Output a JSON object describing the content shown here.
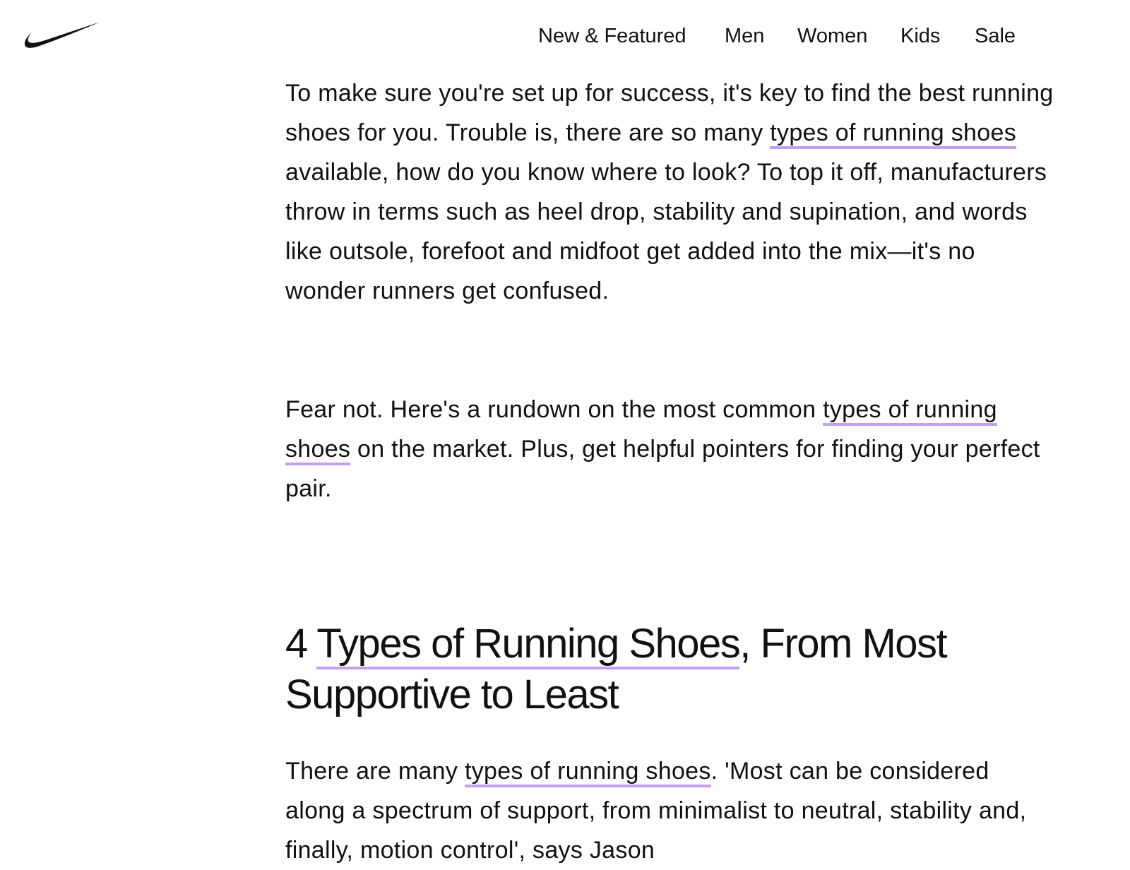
{
  "header": {
    "logo": {
      "icon": "swoosh-icon",
      "color": "#111111"
    },
    "nav": [
      {
        "label": "New & Featured"
      },
      {
        "label": "Men"
      },
      {
        "label": "Women"
      },
      {
        "label": "Kids"
      },
      {
        "label": "Sale"
      }
    ]
  },
  "article": {
    "p1": {
      "before": "To make sure you're set up for success, it's key to find the best running shoes for you. Trouble is, there are so many ",
      "link": "types of running shoes",
      "after": " available, how do you know where to look? To top it off, manufacturers throw in terms such as heel drop, stability and supination, and words like outsole, forefoot and midfoot get added into the mix—it's no wonder runners get confused."
    },
    "p2": {
      "before": "Fear not. Here's a rundown on the most common ",
      "link": "types of running shoes",
      "after": " on the market. Plus, get helpful pointers for finding your perfect pair."
    },
    "heading": {
      "before": "4 ",
      "link": "Types of Running Shoes",
      "after": ", From Most Supportive to Least"
    },
    "p3": {
      "before": "There are many ",
      "link": "types of running shoes",
      "after": ". 'Most can be considered along a spectrum of support, from minimalist to neutral, stability and, finally, motion control', says Jason"
    }
  },
  "colors": {
    "text": "#111111",
    "link_underline": "#c0a0ef",
    "background": "#ffffff"
  }
}
